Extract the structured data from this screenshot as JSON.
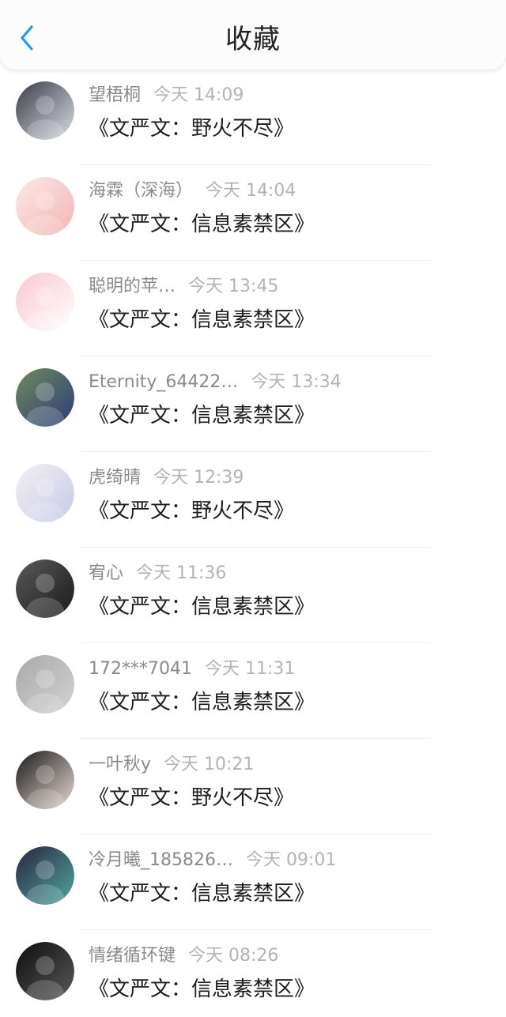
{
  "header": {
    "title": "收藏",
    "back_icon": "chevron-left-icon",
    "accent_color": "#1e9bf0"
  },
  "items": [
    {
      "username": "望梧桐",
      "time": "今天 14:09",
      "title": "《文严文：野火不尽》",
      "avatar_colors": [
        "#3a3d48",
        "#d8dce4"
      ]
    },
    {
      "username": "海霖（深海）",
      "time": "今天 14:04",
      "title": "《文严文：信息素禁区》",
      "avatar_colors": [
        "#fbe9ea",
        "#f3b4b0"
      ]
    },
    {
      "username": "聪明的苹…",
      "time": "今天 13:45",
      "title": "《文严文：信息素禁区》",
      "avatar_colors": [
        "#f8c8d0",
        "#ffffff"
      ]
    },
    {
      "username": "Eternity_64422…",
      "time": "今天 13:34",
      "title": "《文严文：信息素禁区》",
      "avatar_colors": [
        "#6f8a5c",
        "#2c3d78"
      ]
    },
    {
      "username": "虎绮晴",
      "time": "今天 12:39",
      "title": "《文严文：野火不尽》",
      "avatar_colors": [
        "#f3eef4",
        "#c6cbe6"
      ]
    },
    {
      "username": "宥心",
      "time": "今天 11:36",
      "title": "《文严文：信息素禁区》",
      "avatar_colors": [
        "#5a5a5a",
        "#1a1a1a"
      ]
    },
    {
      "username": "172***7041",
      "time": "今天 11:31",
      "title": "《文严文：信息素禁区》",
      "avatar_colors": [
        "#a9a9a9",
        "#d2d2d2"
      ]
    },
    {
      "username": "一叶秋y",
      "time": "今天 10:21",
      "title": "《文严文：野火不尽》",
      "avatar_colors": [
        "#1a1a1a",
        "#e8d9d2"
      ]
    },
    {
      "username": "冷月曦_185826…",
      "time": "今天 09:01",
      "title": "《文严文：信息素禁区》",
      "avatar_colors": [
        "#2a2540",
        "#4fa6a0"
      ]
    },
    {
      "username": "情绪循环键",
      "time": "今天 08:26",
      "title": "《文严文：信息素禁区》",
      "avatar_colors": [
        "#0c0c0c",
        "#5a5a5a"
      ]
    }
  ]
}
